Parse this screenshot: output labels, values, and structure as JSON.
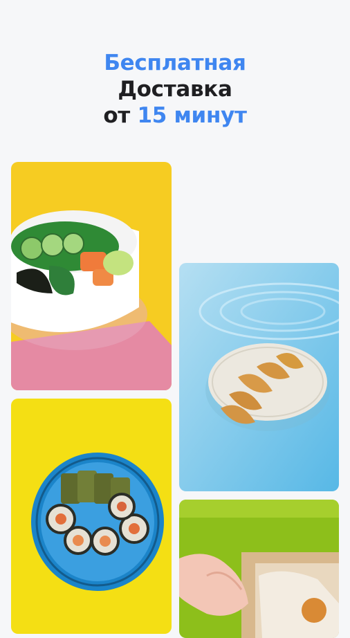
{
  "headline": {
    "line1": "Бесплатная",
    "line2": "Доставка",
    "line3_prefix": "от",
    "line3_highlight": "15 минут"
  },
  "colors": {
    "accent": "#3f86f0",
    "text": "#1f1f22",
    "background": "#f6f7f9"
  },
  "gallery": [
    {
      "name": "poke-bowl-photo"
    },
    {
      "name": "gyoza-photo"
    },
    {
      "name": "sushi-rolls-photo"
    },
    {
      "name": "takeaway-box-photo"
    }
  ]
}
